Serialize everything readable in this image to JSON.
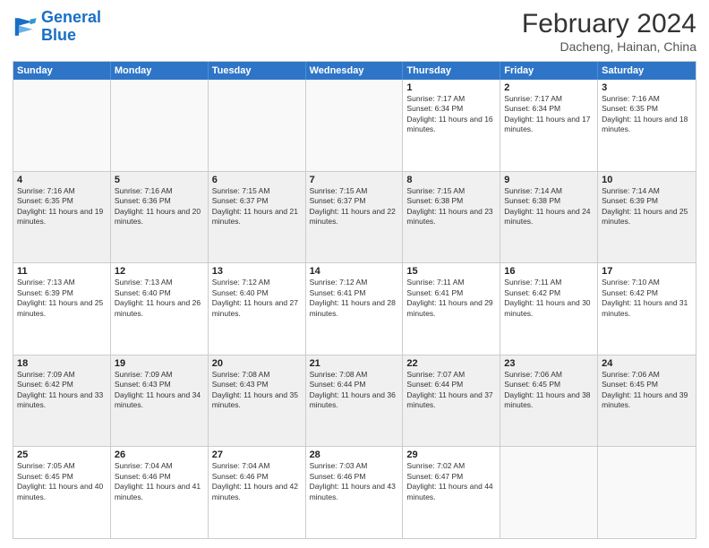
{
  "header": {
    "logo_line1": "General",
    "logo_line2": "Blue",
    "month_year": "February 2024",
    "location": "Dacheng, Hainan, China"
  },
  "days_of_week": [
    "Sunday",
    "Monday",
    "Tuesday",
    "Wednesday",
    "Thursday",
    "Friday",
    "Saturday"
  ],
  "rows": [
    [
      {
        "day": "",
        "info": ""
      },
      {
        "day": "",
        "info": ""
      },
      {
        "day": "",
        "info": ""
      },
      {
        "day": "",
        "info": ""
      },
      {
        "day": "1",
        "info": "Sunrise: 7:17 AM\nSunset: 6:34 PM\nDaylight: 11 hours and 16 minutes."
      },
      {
        "day": "2",
        "info": "Sunrise: 7:17 AM\nSunset: 6:34 PM\nDaylight: 11 hours and 17 minutes."
      },
      {
        "day": "3",
        "info": "Sunrise: 7:16 AM\nSunset: 6:35 PM\nDaylight: 11 hours and 18 minutes."
      }
    ],
    [
      {
        "day": "4",
        "info": "Sunrise: 7:16 AM\nSunset: 6:35 PM\nDaylight: 11 hours and 19 minutes."
      },
      {
        "day": "5",
        "info": "Sunrise: 7:16 AM\nSunset: 6:36 PM\nDaylight: 11 hours and 20 minutes."
      },
      {
        "day": "6",
        "info": "Sunrise: 7:15 AM\nSunset: 6:37 PM\nDaylight: 11 hours and 21 minutes."
      },
      {
        "day": "7",
        "info": "Sunrise: 7:15 AM\nSunset: 6:37 PM\nDaylight: 11 hours and 22 minutes."
      },
      {
        "day": "8",
        "info": "Sunrise: 7:15 AM\nSunset: 6:38 PM\nDaylight: 11 hours and 23 minutes."
      },
      {
        "day": "9",
        "info": "Sunrise: 7:14 AM\nSunset: 6:38 PM\nDaylight: 11 hours and 24 minutes."
      },
      {
        "day": "10",
        "info": "Sunrise: 7:14 AM\nSunset: 6:39 PM\nDaylight: 11 hours and 25 minutes."
      }
    ],
    [
      {
        "day": "11",
        "info": "Sunrise: 7:13 AM\nSunset: 6:39 PM\nDaylight: 11 hours and 25 minutes."
      },
      {
        "day": "12",
        "info": "Sunrise: 7:13 AM\nSunset: 6:40 PM\nDaylight: 11 hours and 26 minutes."
      },
      {
        "day": "13",
        "info": "Sunrise: 7:12 AM\nSunset: 6:40 PM\nDaylight: 11 hours and 27 minutes."
      },
      {
        "day": "14",
        "info": "Sunrise: 7:12 AM\nSunset: 6:41 PM\nDaylight: 11 hours and 28 minutes."
      },
      {
        "day": "15",
        "info": "Sunrise: 7:11 AM\nSunset: 6:41 PM\nDaylight: 11 hours and 29 minutes."
      },
      {
        "day": "16",
        "info": "Sunrise: 7:11 AM\nSunset: 6:42 PM\nDaylight: 11 hours and 30 minutes."
      },
      {
        "day": "17",
        "info": "Sunrise: 7:10 AM\nSunset: 6:42 PM\nDaylight: 11 hours and 31 minutes."
      }
    ],
    [
      {
        "day": "18",
        "info": "Sunrise: 7:09 AM\nSunset: 6:42 PM\nDaylight: 11 hours and 33 minutes."
      },
      {
        "day": "19",
        "info": "Sunrise: 7:09 AM\nSunset: 6:43 PM\nDaylight: 11 hours and 34 minutes."
      },
      {
        "day": "20",
        "info": "Sunrise: 7:08 AM\nSunset: 6:43 PM\nDaylight: 11 hours and 35 minutes."
      },
      {
        "day": "21",
        "info": "Sunrise: 7:08 AM\nSunset: 6:44 PM\nDaylight: 11 hours and 36 minutes."
      },
      {
        "day": "22",
        "info": "Sunrise: 7:07 AM\nSunset: 6:44 PM\nDaylight: 11 hours and 37 minutes."
      },
      {
        "day": "23",
        "info": "Sunrise: 7:06 AM\nSunset: 6:45 PM\nDaylight: 11 hours and 38 minutes."
      },
      {
        "day": "24",
        "info": "Sunrise: 7:06 AM\nSunset: 6:45 PM\nDaylight: 11 hours and 39 minutes."
      }
    ],
    [
      {
        "day": "25",
        "info": "Sunrise: 7:05 AM\nSunset: 6:45 PM\nDaylight: 11 hours and 40 minutes."
      },
      {
        "day": "26",
        "info": "Sunrise: 7:04 AM\nSunset: 6:46 PM\nDaylight: 11 hours and 41 minutes."
      },
      {
        "day": "27",
        "info": "Sunrise: 7:04 AM\nSunset: 6:46 PM\nDaylight: 11 hours and 42 minutes."
      },
      {
        "day": "28",
        "info": "Sunrise: 7:03 AM\nSunset: 6:46 PM\nDaylight: 11 hours and 43 minutes."
      },
      {
        "day": "29",
        "info": "Sunrise: 7:02 AM\nSunset: 6:47 PM\nDaylight: 11 hours and 44 minutes."
      },
      {
        "day": "",
        "info": ""
      },
      {
        "day": "",
        "info": ""
      }
    ]
  ]
}
